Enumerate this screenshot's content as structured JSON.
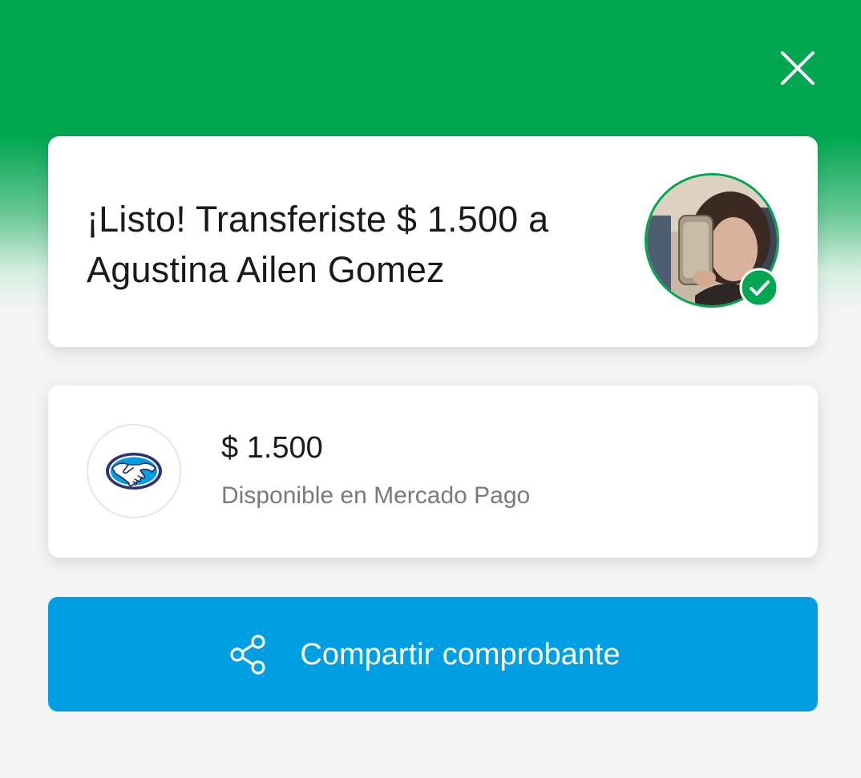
{
  "header": {
    "background_color": "#00a650",
    "close_icon": "close-icon"
  },
  "success_card": {
    "title_line1": "¡Listo! Transferiste $ 1.500 a",
    "title_line2": "Agustina Ailen Gomez",
    "avatar_ring_color": "#00a650",
    "check_icon": "check-icon"
  },
  "amount_card": {
    "logo": "mercado-pago-handshake-logo",
    "amount": "$ 1.500",
    "subtitle": "Disponible en Mercado Pago"
  },
  "share_button": {
    "icon": "share-icon",
    "label": "Compartir comprobante",
    "background_color": "#009ee3"
  }
}
